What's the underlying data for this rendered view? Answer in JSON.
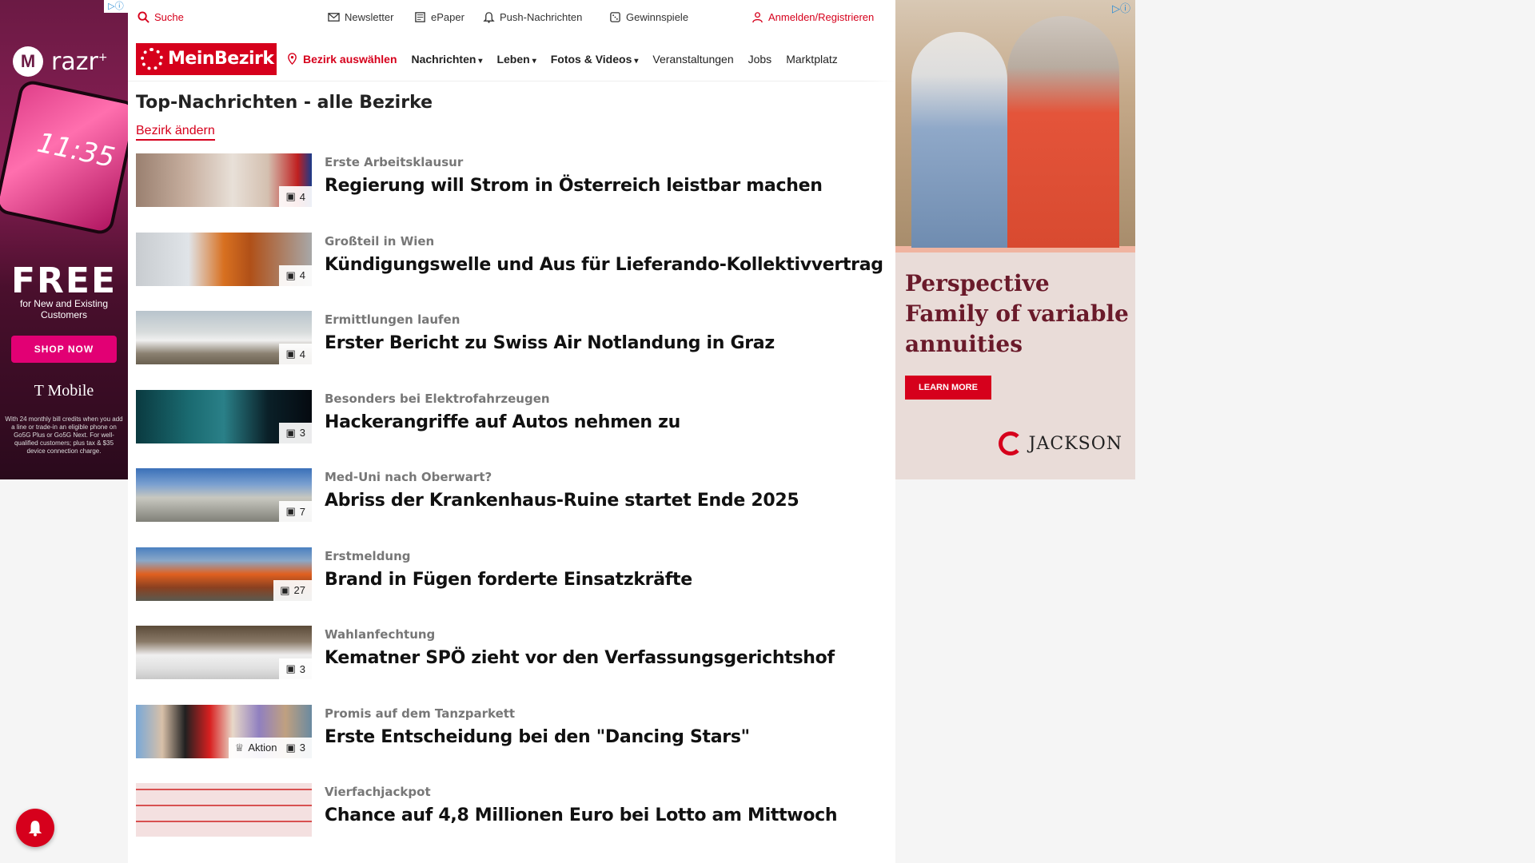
{
  "ad_left": {
    "adchoice": "▷ⓘ",
    "brand": "razr",
    "brand_sup": "+",
    "phone_time": "11:35",
    "free": "FREE",
    "free_sub": "for New and Existing Customers",
    "cta": "SHOP NOW",
    "carrier": "T Mobile",
    "fine_print": "With 24 monthly bill credits when you add a line or trade-in an eligible phone on Go5G Plus or Go5G Next. For well-qualified customers; plus tax & $35 device connection charge."
  },
  "topbar": {
    "search": "Suche",
    "newsletter": "Newsletter",
    "epaper": "ePaper",
    "push": "Push-Nachrichten",
    "games": "Gewinnspiele",
    "login": "Anmelden/Registrieren"
  },
  "navbar": {
    "logo": "MeinBezirk",
    "bezirk": "Bezirk auswählen",
    "items": [
      "Nachrichten",
      "Leben",
      "Fotos & Videos",
      "Veranstaltungen",
      "Jobs",
      "Marktplatz"
    ]
  },
  "page": {
    "title": "Top-Nachrichten - alle Bezirke",
    "change_bezirk": "Bezirk ändern"
  },
  "articles": [
    {
      "kicker": "Erste Arbeitsklausur",
      "headline": "Regierung will Strom in Österreich leistbar machen",
      "count": "4"
    },
    {
      "kicker": "Großteil in Wien",
      "headline": "Kündigungswelle und Aus für Lieferando-Kollektivvertrag",
      "count": "4"
    },
    {
      "kicker": "Ermittlungen laufen",
      "headline": "Erster Bericht zu Swiss Air Notlandung in Graz",
      "count": "4"
    },
    {
      "kicker": "Besonders bei Elektrofahrzeugen",
      "headline": "Hackerangriffe auf Autos nehmen zu",
      "count": "3"
    },
    {
      "kicker": "Med-Uni nach Oberwart?",
      "headline": "Abriss der Krankenhaus-Ruine startet Ende 2025",
      "count": "7"
    },
    {
      "kicker": "Erstmeldung",
      "headline": "Brand in Fügen forderte Einsatzkräfte",
      "count": "27"
    },
    {
      "kicker": "Wahlanfechtung",
      "headline": "Kematner SPÖ zieht vor den Verfassungsgerichtshof",
      "count": "3"
    },
    {
      "kicker": "Promis auf dem Tanzparkett",
      "headline": "Erste Entscheidung bei den \"Dancing Stars\"",
      "count": "3",
      "tag": "Aktion"
    },
    {
      "kicker": "Vierfachjackpot",
      "headline": "Chance auf 4,8 Millionen Euro bei Lotto am Mittwoch",
      "count": ""
    }
  ],
  "ad_right": {
    "adchoice": "▷ⓘ",
    "headline": "Perspective Family of variable annuities",
    "cta": "LEARN MORE",
    "brand": "JACKSON"
  },
  "colors": {
    "brand_red": "#d6001c",
    "tmobile_magenta": "#e20074"
  }
}
